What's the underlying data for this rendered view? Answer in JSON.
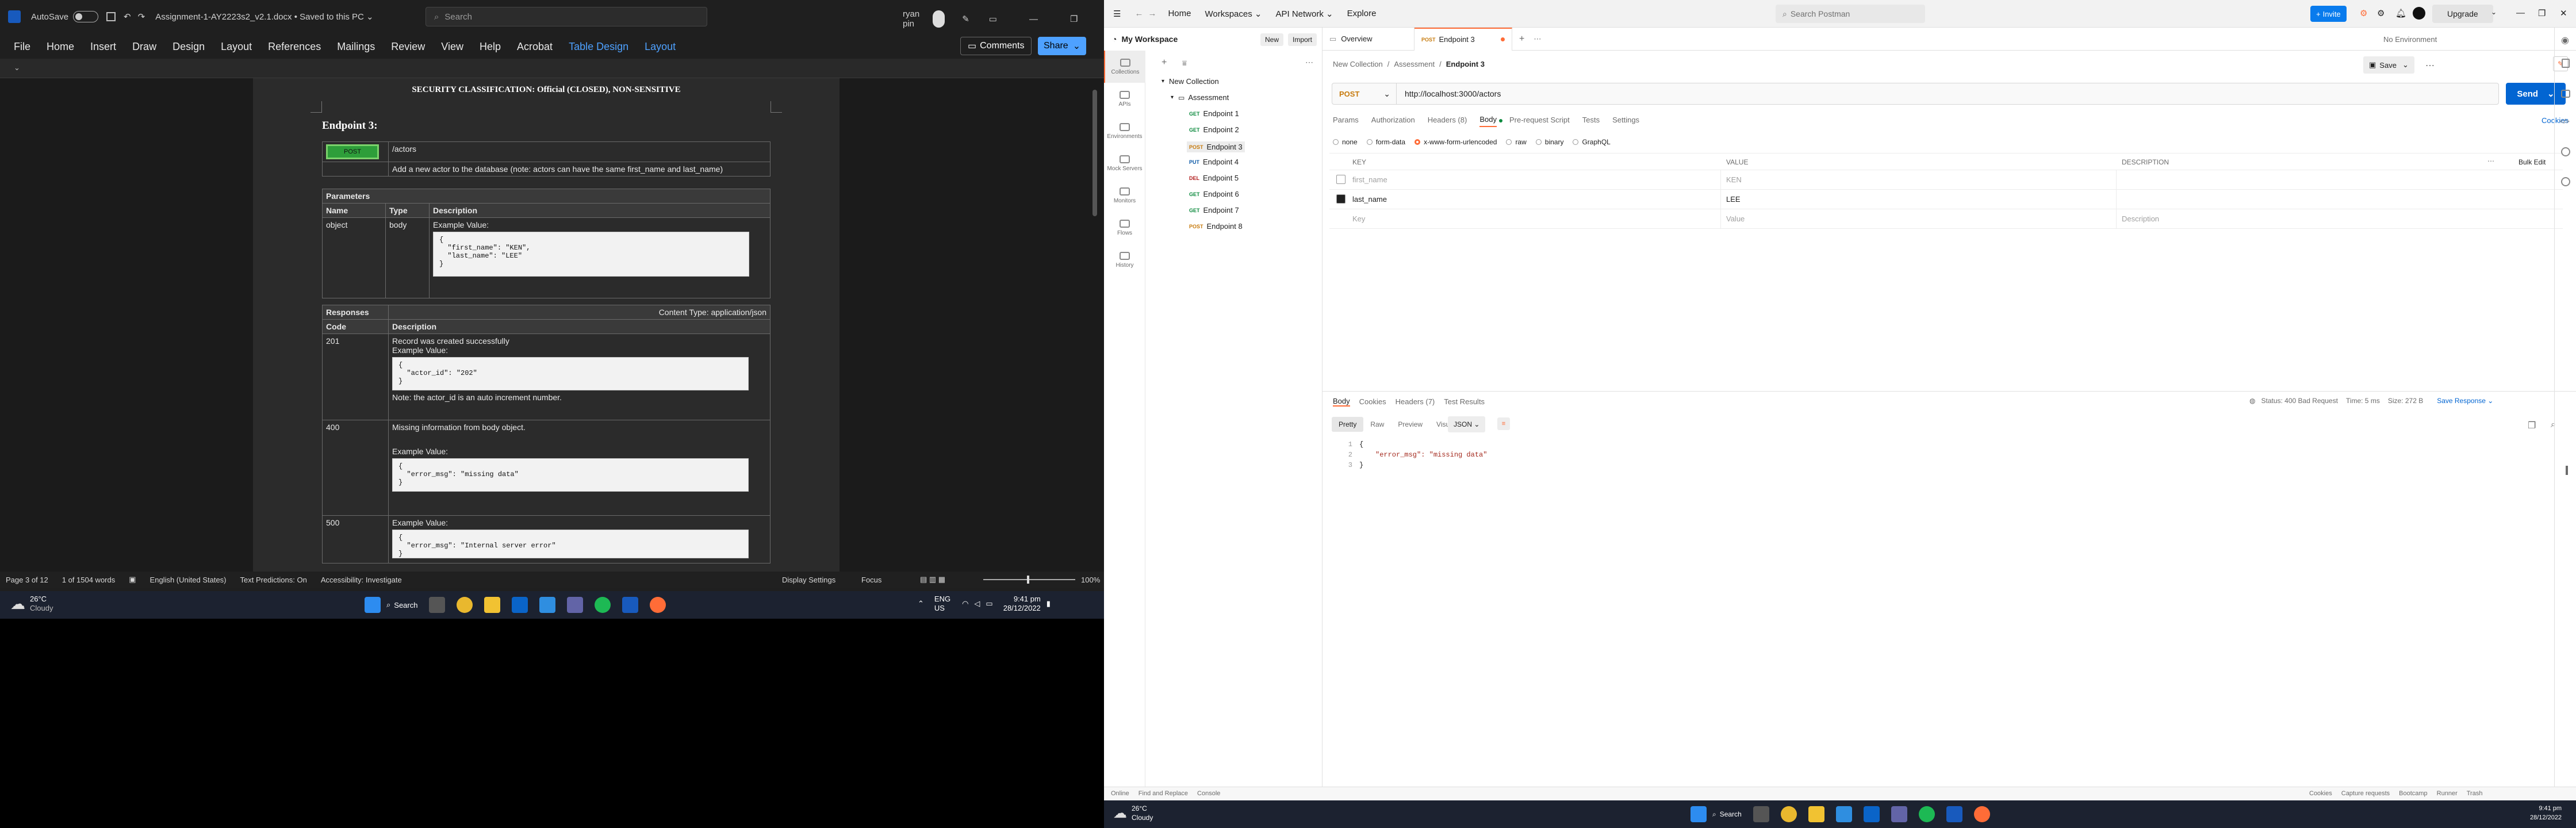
{
  "word": {
    "title_bar": {
      "autosave_label": "AutoSave",
      "autosave_state": "Off",
      "doc_title": "Assignment-1-AY2223s2_v2.1.docx • Saved to this PC ⌄",
      "search_placeholder": "Search",
      "user_name": "ryan pin"
    },
    "ribbon_tabs": [
      "File",
      "Home",
      "Insert",
      "Draw",
      "Design",
      "Layout",
      "References",
      "Mailings",
      "Review",
      "View",
      "Help",
      "Acrobat",
      "Table Design",
      "Layout"
    ],
    "comments_label": "Comments",
    "share_label": "Share",
    "doc": {
      "classification": "SECURITY CLASSIFICATION: Official (CLOSED), NON-SENSITIVE",
      "heading": "Endpoint 3:",
      "method_badge": "POST",
      "path": "/actors",
      "summary": "Add a new actor to the database (note: actors can have the same first_name and last_name)",
      "params_title": "Parameters",
      "col_name": "Name",
      "col_type": "Type",
      "col_desc": "Description",
      "param_name": "object",
      "param_type": "body",
      "example_label": "Example Value:",
      "param_code": "{\n  \"first_name\": \"KEN\",\n  \"last_name\": \"LEE\"\n}",
      "responses_title": "Responses",
      "content_type": "Content Type: application/json",
      "code_col": "Code",
      "resp": [
        {
          "code": "201",
          "text": "Record was created successfully",
          "example": "Example Value:",
          "code_block": "{\n  \"actor_id\": \"202\"\n}",
          "note": "Note: the actor_id is an auto increment number."
        },
        {
          "code": "400",
          "text": "Missing information from body object.",
          "example": "Example Value:",
          "code_block": "{\n  \"error_msg\": \"missing data\"\n}",
          "note": ""
        },
        {
          "code": "500",
          "text": "Example Value:",
          "example": "",
          "code_block": "{\n  \"error_msg\": \"Internal server error\"\n}",
          "note": ""
        }
      ]
    },
    "status_bar": {
      "page": "Page 3 of 12",
      "words": "1 of 1504 words",
      "language": "English (United States)",
      "predictions": "Text Predictions: On",
      "accessibility": "Accessibility: Investigate",
      "display": "Display Settings",
      "focus": "Focus",
      "zoom": "100%"
    }
  },
  "taskbar_left": {
    "weather_temp": "26°C",
    "weather_desc": "Cloudy",
    "search_label": "Search",
    "lang": "ENG",
    "region": "US",
    "time": "9:41 pm",
    "date": "28/12/2022"
  },
  "postman": {
    "topnav": [
      "Home",
      "Workspaces ⌄",
      "API Network ⌄",
      "Explore"
    ],
    "search_placeholder": "Search Postman",
    "invite_label": "Invite",
    "upgrade_label": "Upgrade",
    "no_env": "No Environment",
    "workspace_name": "My Workspace",
    "new_label": "New",
    "import_label": "Import",
    "rail": [
      "Collections",
      "APIs",
      "Environments",
      "Mock Servers",
      "Monitors",
      "Flows",
      "History"
    ],
    "collection_name": "New Collection",
    "folder_name": "Assessment",
    "requests": [
      {
        "method": "GET",
        "name": "Endpoint 1"
      },
      {
        "method": "GET",
        "name": "Endpoint 2"
      },
      {
        "method": "POST",
        "name": "Endpoint 3"
      },
      {
        "method": "PUT",
        "name": "Endpoint 4"
      },
      {
        "method": "DEL",
        "name": "Endpoint 5"
      },
      {
        "method": "GET",
        "name": "Endpoint 6"
      },
      {
        "method": "GET",
        "name": "Endpoint 7"
      },
      {
        "method": "POST",
        "name": "Endpoint 8"
      }
    ],
    "tabs": {
      "overview": "Overview",
      "active": "Endpoint 3",
      "active_method": "POST"
    },
    "breadcrumb": [
      "New Collection",
      "Assessment",
      "Endpoint 3"
    ],
    "save_label": "Save",
    "method": "POST",
    "url": "http://localhost:3000/actors",
    "send_label": "Send",
    "req_tabs": [
      "Params",
      "Authorization",
      "Headers (8)",
      "Body",
      "Pre-request Script",
      "Tests",
      "Settings"
    ],
    "cookies_label": "Cookies",
    "body_types": [
      "none",
      "form-data",
      "x-www-form-urlencoded",
      "raw",
      "binary",
      "GraphQL"
    ],
    "kv_headers": {
      "key": "KEY",
      "value": "VALUE",
      "desc": "DESCRIPTION",
      "bulk": "Bulk Edit"
    },
    "kv_rows": [
      {
        "key": "first_name",
        "value": "KEN",
        "desc": "",
        "checked": false
      },
      {
        "key": "last_name",
        "value": "LEE",
        "desc": "",
        "checked": true
      },
      {
        "key": "Key",
        "value": "Value",
        "desc": "Description",
        "checked": false
      }
    ],
    "resp_tabs": [
      "Body",
      "Cookies",
      "Headers (7)",
      "Test Results"
    ],
    "resp_status": "Status: 400 Bad Request",
    "resp_time": "Time: 5 ms",
    "resp_size": "Size: 272 B",
    "save_response": "Save Response ⌄",
    "resp_views": [
      "Pretty",
      "Raw",
      "Preview",
      "Visualize"
    ],
    "resp_format": "JSON ⌄",
    "resp_lines": [
      "{",
      "\"error_msg\": \"missing data\"",
      "}"
    ],
    "status_bar": [
      "Online",
      "Find and Replace",
      "Console",
      "Cookies",
      "Capture requests",
      "Bootcamp",
      "Runner",
      "Trash"
    ]
  },
  "taskbar_right": {
    "weather_temp": "26°C",
    "weather_desc": "Cloudy",
    "search_label": "Search",
    "time": "9:41 pm",
    "date": "28/12/2022"
  },
  "colors": {
    "word_blue": "#4ea1ff",
    "postman_orange": "#ff6c37",
    "send_blue": "#0265d2",
    "invite_blue": "#097bed"
  }
}
